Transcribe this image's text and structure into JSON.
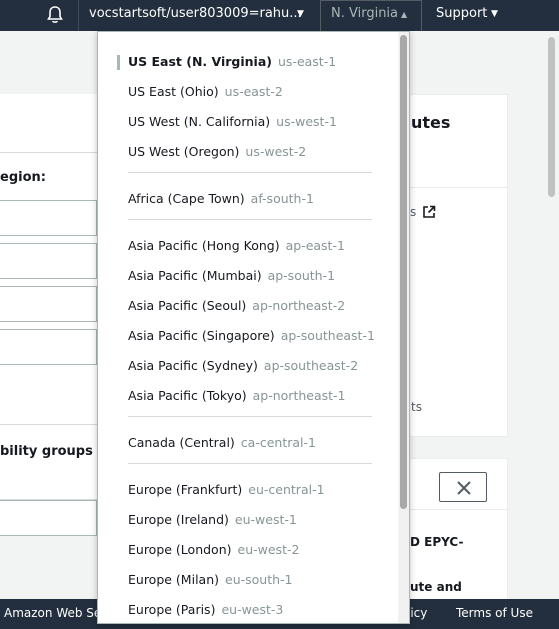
{
  "nav": {
    "account": "vocstartsoft/user803009=rahu...",
    "region": "N. Virginia",
    "support": "Support"
  },
  "background": {
    "left_label_region": "egion:",
    "left_label_groups": "bility groups on",
    "right_title": "utes",
    "right_link": "s",
    "right_ts": "ts",
    "right_lines": [
      "D EPYC-",
      "ute and"
    ]
  },
  "regions": {
    "groups": [
      [
        {
          "name": "US East (N. Virginia)",
          "code": "us-east-1",
          "selected": true
        },
        {
          "name": "US East (Ohio)",
          "code": "us-east-2"
        },
        {
          "name": "US West (N. California)",
          "code": "us-west-1"
        },
        {
          "name": "US West (Oregon)",
          "code": "us-west-2"
        }
      ],
      [
        {
          "name": "Africa (Cape Town)",
          "code": "af-south-1"
        }
      ],
      [
        {
          "name": "Asia Pacific (Hong Kong)",
          "code": "ap-east-1"
        },
        {
          "name": "Asia Pacific (Mumbai)",
          "code": "ap-south-1"
        },
        {
          "name": "Asia Pacific (Seoul)",
          "code": "ap-northeast-2"
        },
        {
          "name": "Asia Pacific (Singapore)",
          "code": "ap-southeast-1"
        },
        {
          "name": "Asia Pacific (Sydney)",
          "code": "ap-southeast-2"
        },
        {
          "name": "Asia Pacific (Tokyo)",
          "code": "ap-northeast-1"
        }
      ],
      [
        {
          "name": "Canada (Central)",
          "code": "ca-central-1"
        }
      ],
      [
        {
          "name": "Europe (Frankfurt)",
          "code": "eu-central-1"
        },
        {
          "name": "Europe (Ireland)",
          "code": "eu-west-1"
        },
        {
          "name": "Europe (London)",
          "code": "eu-west-2"
        },
        {
          "name": "Europe (Milan)",
          "code": "eu-south-1"
        },
        {
          "name": "Europe (Paris)",
          "code": "eu-west-3"
        }
      ]
    ]
  },
  "footer": {
    "left": "Amazon Web Se",
    "policy": "licy",
    "terms": "Terms of Use"
  },
  "colors": {
    "nav_bg": "#232f3e",
    "selected_marker": "#aab7b8",
    "region_code": "#879596"
  }
}
